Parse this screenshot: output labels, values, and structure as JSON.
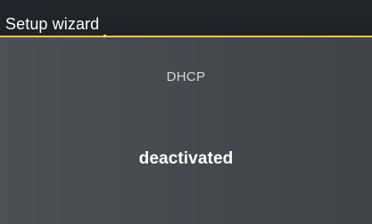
{
  "header": {
    "title": "Setup wizard"
  },
  "main": {
    "setting_label": "DHCP",
    "setting_value": "deactivated"
  },
  "colors": {
    "header_background": "#202327",
    "accent": "#f0c44a",
    "body_background": "#474a4f"
  }
}
